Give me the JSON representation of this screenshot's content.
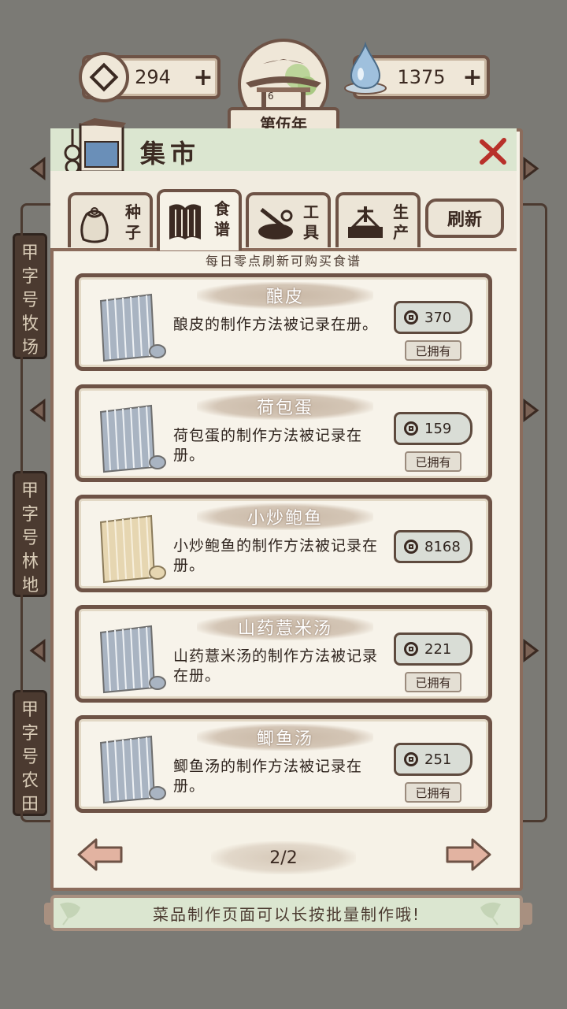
{
  "currency": {
    "coins": "294",
    "water": "1375",
    "plus_symbol": "+"
  },
  "year": {
    "emblem_number": "6",
    "label": "第伍年"
  },
  "side_boards": [
    {
      "label": "甲字号牧场"
    },
    {
      "label": "甲字号林地"
    },
    {
      "label": "甲字号农田"
    }
  ],
  "market": {
    "title": "集市",
    "tabs": [
      {
        "label": "种子",
        "icon": "seed-bag-icon"
      },
      {
        "label": "食谱",
        "icon": "recipe-book-icon"
      },
      {
        "label": "工具",
        "icon": "tools-icon"
      },
      {
        "label": "生产",
        "icon": "production-icon"
      }
    ],
    "active_tab": "食谱",
    "refresh_label": "刷新",
    "notice": "每日零点刷新可购买食谱"
  },
  "recipes": [
    {
      "name": "酿皮",
      "desc": "酿皮的制作方法被记录在册。",
      "price": "370",
      "owned_label": "已拥有",
      "scroll_color": "#a9b4c2"
    },
    {
      "name": "荷包蛋",
      "desc": "荷包蛋的制作方法被记录在册。",
      "price": "159",
      "owned_label": "已拥有",
      "scroll_color": "#a9b4c2"
    },
    {
      "name": "小炒鲍鱼",
      "desc": "小炒鲍鱼的制作方法被记录在册。",
      "price": "8168",
      "owned_label": "",
      "scroll_color": "#e6d6b1"
    },
    {
      "name": "山药薏米汤",
      "desc": "山药薏米汤的制作方法被记录在册。",
      "price": "221",
      "owned_label": "已拥有",
      "scroll_color": "#a9b4c2"
    },
    {
      "name": "鲫鱼汤",
      "desc": "鲫鱼汤的制作方法被记录在册。",
      "price": "251",
      "owned_label": "已拥有",
      "scroll_color": "#a9b4c2"
    }
  ],
  "pager": {
    "label": "2/2"
  },
  "tip": "菜品制作页面可以长按批量制作哦!",
  "colors": {
    "background": "#7b7a75",
    "panel": "#f6f2e7",
    "border": "#6e5346",
    "header": "#dbe6d0",
    "close_red": "#b8312a",
    "arrow_pink": "#e2b3a1"
  }
}
